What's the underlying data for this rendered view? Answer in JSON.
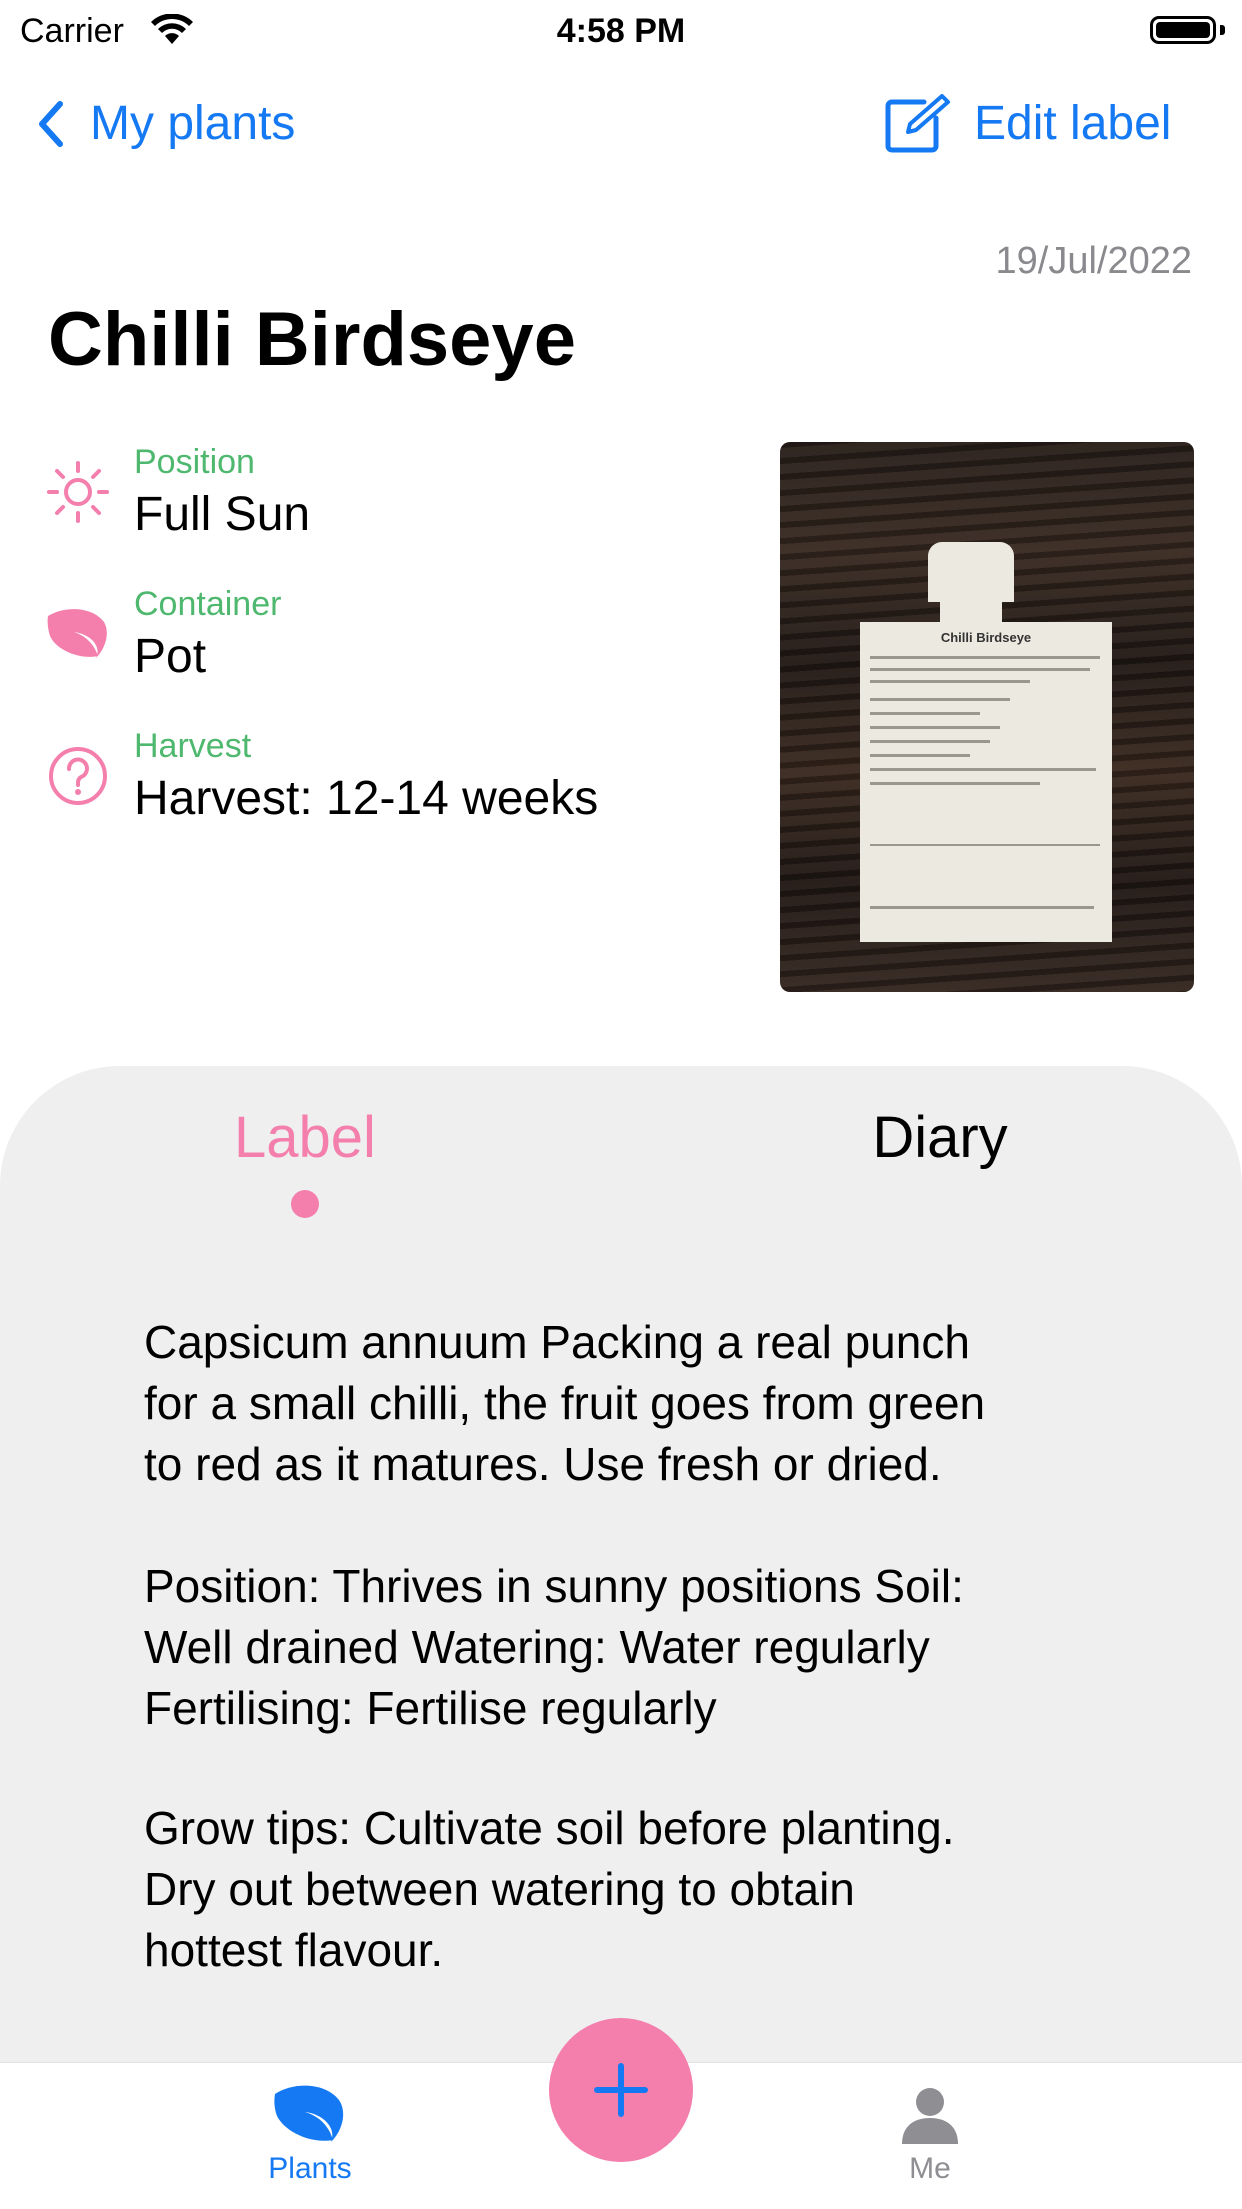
{
  "status_bar": {
    "carrier": "Carrier",
    "time": "4:58 PM"
  },
  "nav": {
    "back_label": "My plants",
    "edit_label": "Edit label"
  },
  "plant": {
    "date": "19/Jul/2022",
    "name": "Chilli Birdseye",
    "attributes": [
      {
        "label": "Position",
        "value": "Full Sun",
        "icon": "sun-icon"
      },
      {
        "label": "Container",
        "value": "Pot",
        "icon": "leaf-icon"
      },
      {
        "label": "Harvest",
        "value": "Harvest: 12-14 weeks",
        "icon": "question-icon"
      }
    ],
    "photo": {
      "packet_title": "Chilli Birdseye"
    }
  },
  "tabs": {
    "label": "Label",
    "diary": "Diary",
    "selected": "Label"
  },
  "label_text": {
    "p1": [
      "Capsicum annuum Packing a real punch",
      "for a small chilli, the fruit goes from green",
      "to red as it matures. Use fresh or dried."
    ],
    "p2": [
      "Position: Thrives in sunny positions Soil:",
      "Well drained Watering: Water regularly",
      "Fertilising: Fertilise regularly"
    ],
    "p3": [
      "Grow tips: Cultivate soil before planting.",
      "Dry out between watering to obtain",
      "hottest flavour."
    ]
  },
  "tab_bar": {
    "plants": "Plants",
    "me": "Me",
    "active": "Plants"
  },
  "colors": {
    "accent_blue": "#1479f2",
    "accent_pink": "#f47fac",
    "label_green": "#4fb86f",
    "sheet_bg": "#efefef"
  }
}
